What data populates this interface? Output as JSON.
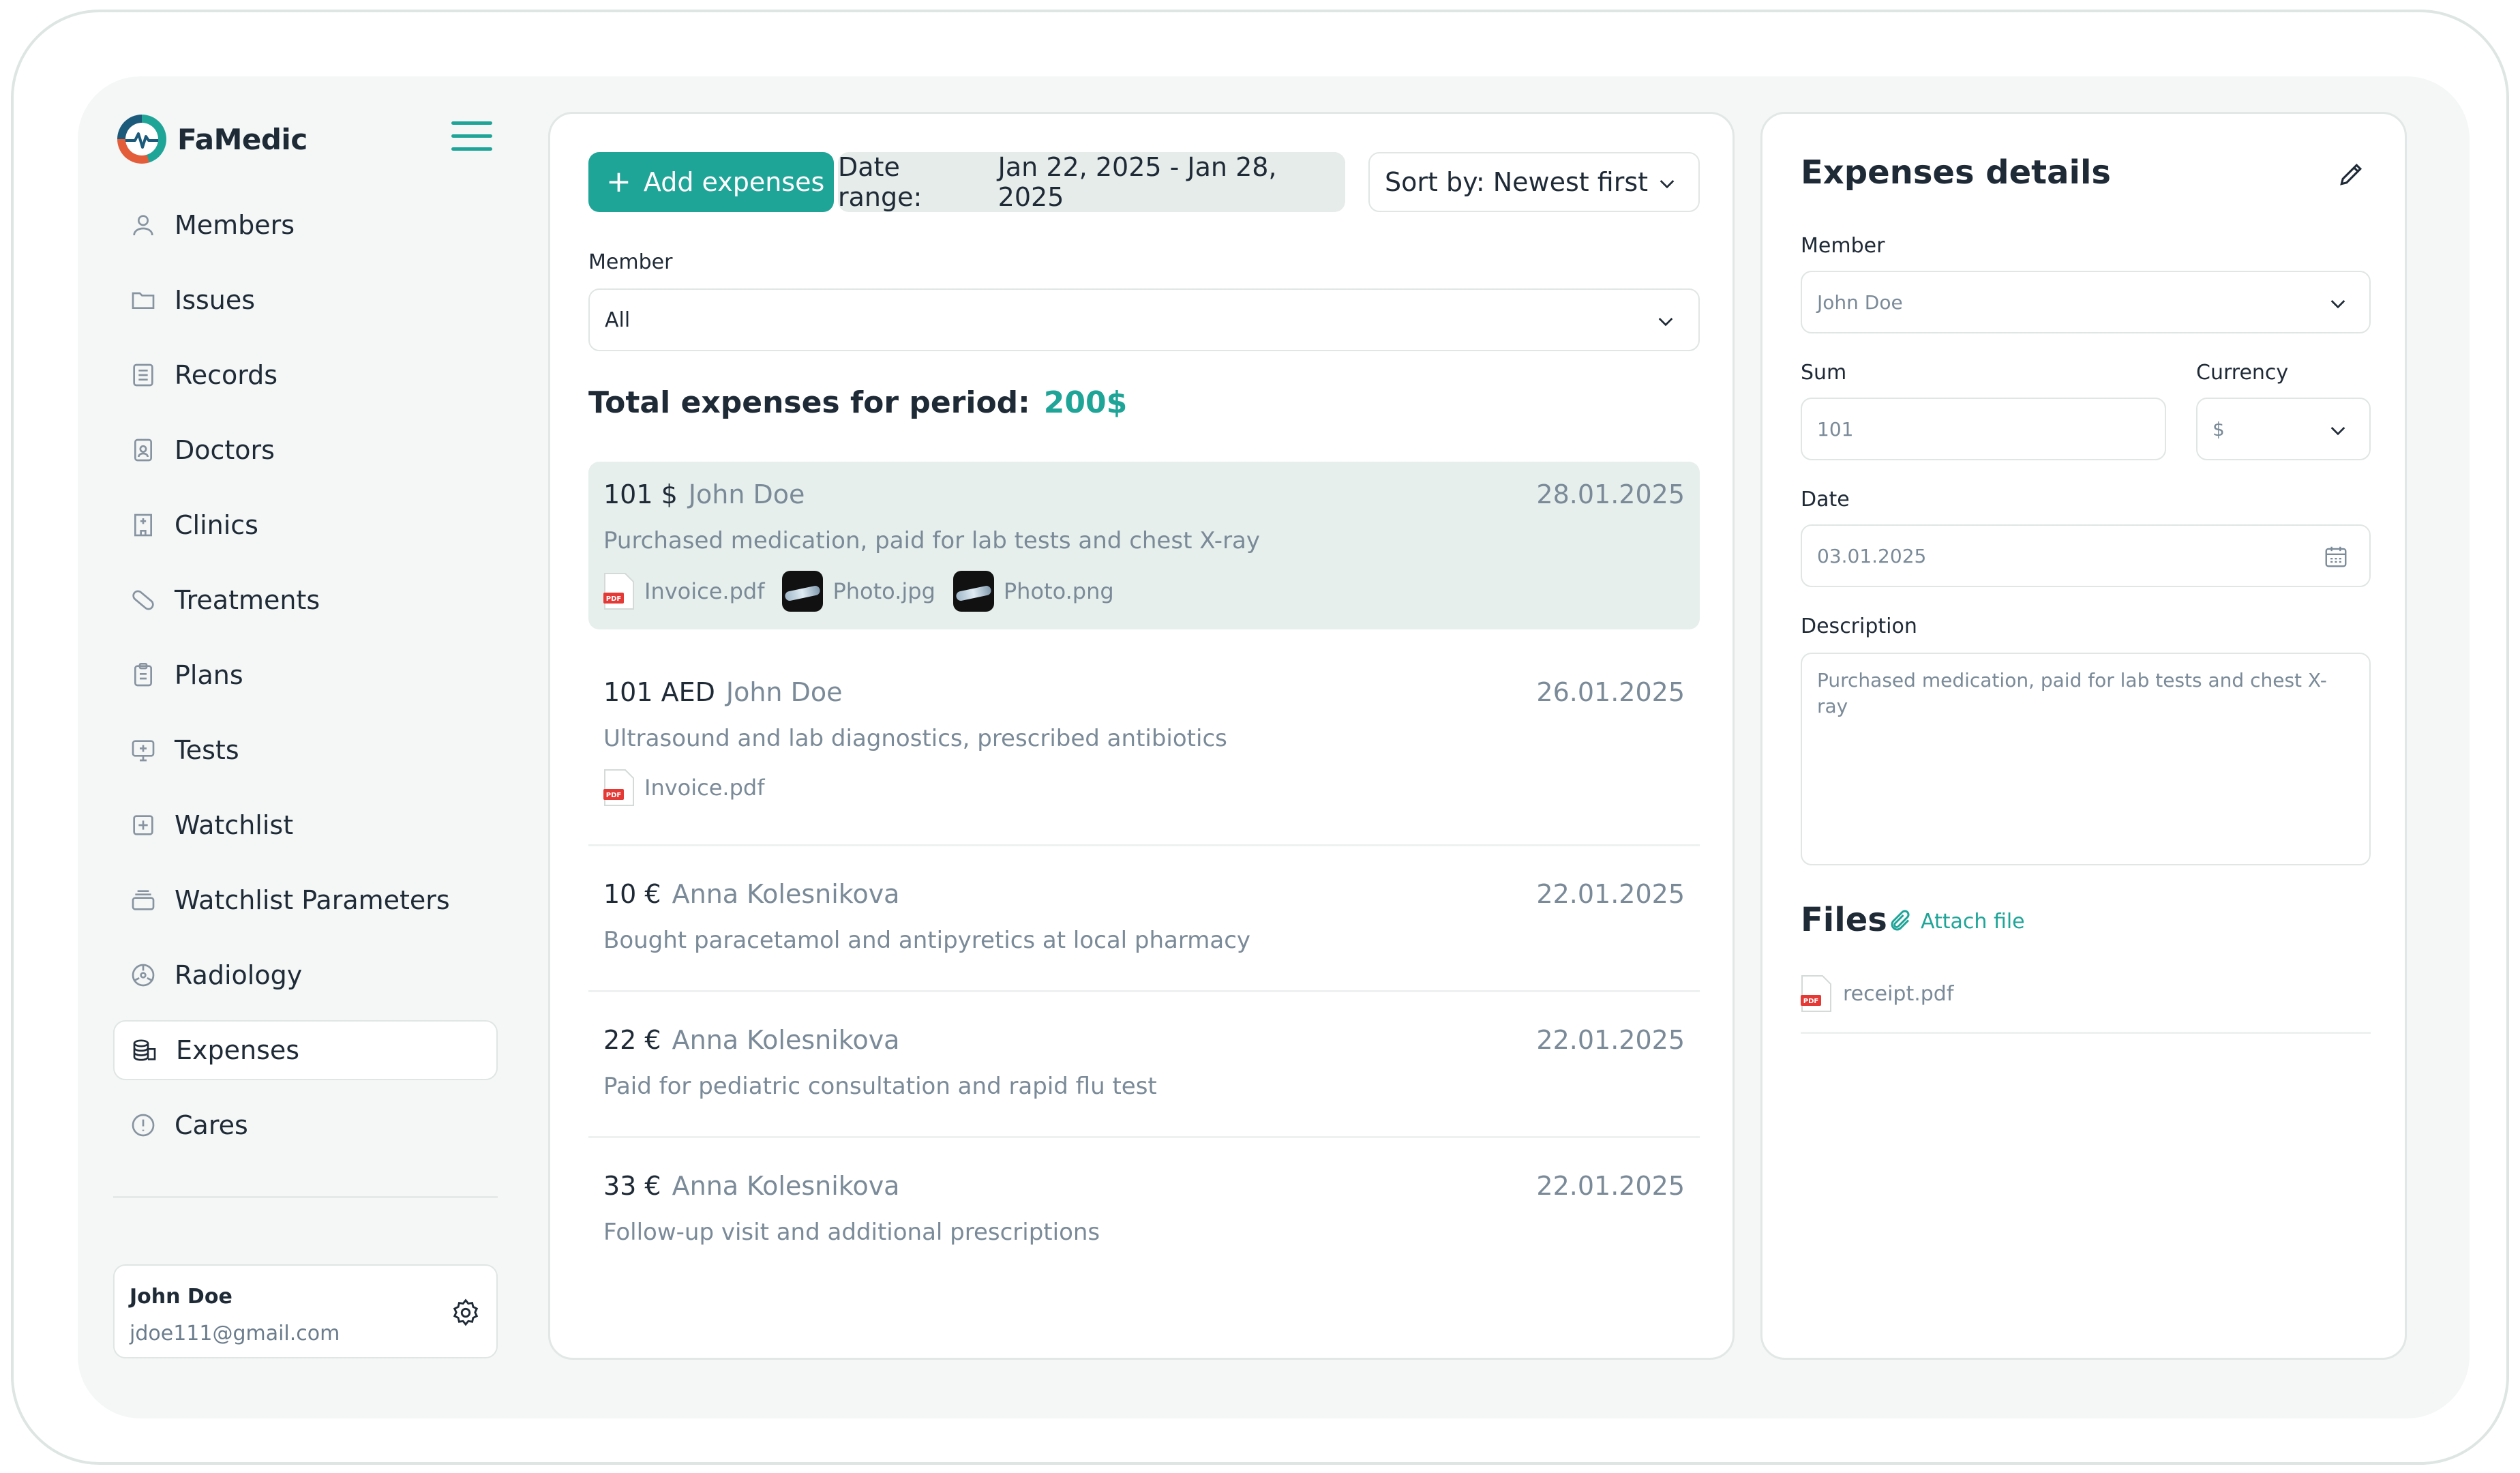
{
  "brand": {
    "name": "FaMedic"
  },
  "sidebar": {
    "items": [
      {
        "label": "Members",
        "icon": "user-icon"
      },
      {
        "label": "Issues",
        "icon": "folder-icon"
      },
      {
        "label": "Records",
        "icon": "document-list-icon"
      },
      {
        "label": "Doctors",
        "icon": "doctor-badge-icon"
      },
      {
        "label": "Clinics",
        "icon": "hospital-icon"
      },
      {
        "label": "Treatments",
        "icon": "pill-icon"
      },
      {
        "label": "Plans",
        "icon": "clipboard-icon"
      },
      {
        "label": "Tests",
        "icon": "monitor-plus-icon"
      },
      {
        "label": "Watchlist",
        "icon": "watchlist-icon"
      },
      {
        "label": "Watchlist Parameters",
        "icon": "stack-icon"
      },
      {
        "label": "Radiology",
        "icon": "radiation-icon"
      },
      {
        "label": "Expenses",
        "icon": "coins-icon",
        "active": true
      },
      {
        "label": "Cares",
        "icon": "info-circle-icon"
      }
    ]
  },
  "user": {
    "name": "John Doe",
    "email": "jdoe111@gmail.com"
  },
  "toolbar": {
    "add_label": "Add expenses",
    "date_range_label": "Date range:",
    "date_range_value": "Jan 22, 2025 - Jan 28, 2025",
    "sort_label": "Sort by:",
    "sort_value": "Newest first"
  },
  "filter": {
    "member_label": "Member",
    "member_value": "All"
  },
  "total": {
    "label": "Total expenses for period:",
    "amount": "200$"
  },
  "expenses": [
    {
      "amount": "101 $",
      "member": "John Doe",
      "date": "28.01.2025",
      "description": "Purchased medication, paid for lab tests and chest X-ray",
      "files": [
        "Invoice.pdf",
        "Photo.jpg",
        "Photo.png"
      ]
    },
    {
      "amount": "101 AED",
      "member": "John Doe",
      "date": "26.01.2025",
      "description": "Ultrasound and lab diagnostics, prescribed antibiotics",
      "files": [
        "Invoice.pdf"
      ]
    },
    {
      "amount": "10 €",
      "member": "Anna Kolesnikova",
      "date": "22.01.2025",
      "description": "Bought paracetamol and antipyretics at local pharmacy"
    },
    {
      "amount": "22 €",
      "member": "Anna Kolesnikova",
      "date": "22.01.2025",
      "description": "Paid for pediatric consultation and rapid flu test"
    },
    {
      "amount": "33 €",
      "member": "Anna Kolesnikova",
      "date": "22.01.2025",
      "description": "Follow-up visit and additional prescriptions"
    }
  ],
  "details": {
    "title": "Expenses details",
    "member_label": "Member",
    "member_value": "John Doe",
    "sum_label": "Sum",
    "sum_value": "101",
    "currency_label": "Currency",
    "currency_value": "$",
    "date_label": "Date",
    "date_value": "03.01.2025",
    "description_label": "Description",
    "description_value": "Purchased medication, paid for lab tests and chest X-ray",
    "files_title": "Files",
    "attach_label": "Attach file",
    "file_name": "receipt.pdf"
  },
  "colors": {
    "accent": "#1fa498",
    "pdf_red": "#e53935",
    "selected_row": "#e6efec"
  }
}
